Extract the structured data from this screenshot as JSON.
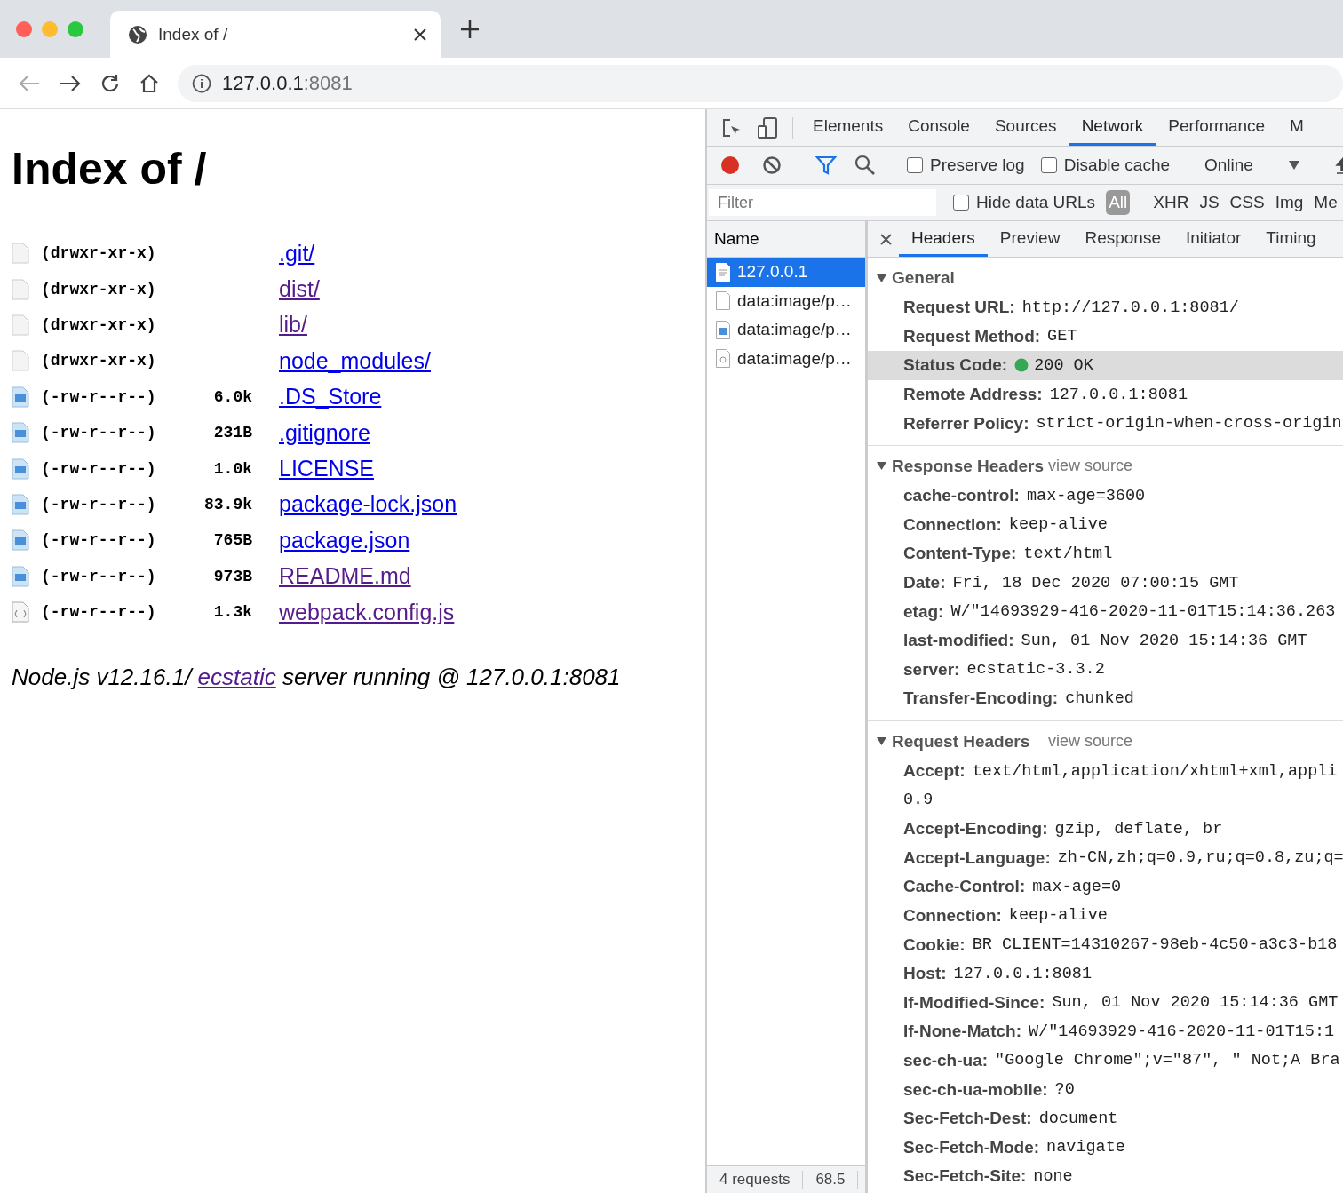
{
  "browser": {
    "tab_title": "Index of /",
    "url_host": "127.0.0.1",
    "url_port": ":8081",
    "back_disabled": true
  },
  "page": {
    "title": "Index of /",
    "entries": [
      {
        "kind": "folder",
        "perms": "(drwxr-xr-x)",
        "name": ".git/",
        "visited": false
      },
      {
        "kind": "folder",
        "perms": "(drwxr-xr-x)",
        "name": "dist/",
        "visited": true
      },
      {
        "kind": "folder",
        "perms": "(drwxr-xr-x)",
        "name": "lib/",
        "visited": true
      },
      {
        "kind": "folder",
        "perms": "(drwxr-xr-x)",
        "name": "node_modules/",
        "visited": false
      },
      {
        "kind": "file",
        "perms": "(-rw-r--r--)",
        "size": "6.0k",
        "name": ".DS_Store",
        "visited": false
      },
      {
        "kind": "file",
        "perms": "(-rw-r--r--)",
        "size": "231B",
        "name": ".gitignore",
        "visited": false
      },
      {
        "kind": "file",
        "perms": "(-rw-r--r--)",
        "size": "1.0k",
        "name": "LICENSE",
        "visited": false
      },
      {
        "kind": "file",
        "perms": "(-rw-r--r--)",
        "size": "83.9k",
        "name": "package-lock.json",
        "visited": false
      },
      {
        "kind": "file",
        "perms": "(-rw-r--r--)",
        "size": "765B",
        "name": "package.json",
        "visited": false
      },
      {
        "kind": "file",
        "perms": "(-rw-r--r--)",
        "size": "973B",
        "name": "README.md",
        "visited": true
      },
      {
        "kind": "script",
        "perms": "(-rw-r--r--)",
        "size": "1.3k",
        "name": "webpack.config.js",
        "visited": true
      }
    ],
    "footer": {
      "before": "Node.js v12.16.1/",
      "link": "ecstatic",
      "link_visited": true,
      "after": "server running @ 127.0.0.1:8081"
    }
  },
  "devtools": {
    "panels": [
      {
        "label": "Elements",
        "selected": false
      },
      {
        "label": "Console",
        "selected": false
      },
      {
        "label": "Sources",
        "selected": false
      },
      {
        "label": "Network",
        "selected": true
      },
      {
        "label": "Performance",
        "selected": false
      },
      {
        "label": "M",
        "selected": false
      }
    ],
    "toolbar": {
      "recording": true,
      "filter_active": true,
      "preserve_log": {
        "label": "Preserve log",
        "checked": false
      },
      "disable_cache": {
        "label": "Disable cache",
        "checked": false
      },
      "throttling": "Online"
    },
    "filter": {
      "placeholder": "Filter",
      "hide_data_urls": {
        "label": "Hide data URLs",
        "checked": false
      },
      "types": [
        {
          "label": "All",
          "selected": true
        },
        {
          "label": "XHR",
          "selected": false
        },
        {
          "label": "JS",
          "selected": false
        },
        {
          "label": "CSS",
          "selected": false
        },
        {
          "label": "Img",
          "selected": false
        },
        {
          "label": "Me",
          "selected": false
        }
      ]
    },
    "name_column": "Name",
    "requests": [
      {
        "kind": "document",
        "name": "127.0.0.1",
        "selected": true
      },
      {
        "kind": "blank",
        "name": "data:image/p…",
        "selected": false
      },
      {
        "kind": "image",
        "name": "data:image/p…",
        "selected": false
      },
      {
        "kind": "picture",
        "name": "data:image/p…",
        "selected": false
      }
    ],
    "summary": [
      "4 requests",
      "68.5"
    ],
    "detail_tabs": [
      {
        "label": "Headers",
        "selected": true
      },
      {
        "label": "Preview",
        "selected": false
      },
      {
        "label": "Response",
        "selected": false
      },
      {
        "label": "Initiator",
        "selected": false
      },
      {
        "label": "Timing",
        "selected": false
      }
    ],
    "sections": [
      {
        "title": "General",
        "expanded": true,
        "rows": [
          {
            "key": "Request URL:",
            "value": "http://127.0.0.1:8081/",
            "highlighted": false
          },
          {
            "key": "Request Method:",
            "value": "GET",
            "highlighted": false
          },
          {
            "key": "Status Code:",
            "value": "200  OK",
            "status_ok": true,
            "highlighted": true
          },
          {
            "key": "Remote Address:",
            "value": "127.0.0.1:8081",
            "highlighted": false
          },
          {
            "key": "Referrer Policy:",
            "value": "strict-origin-when-cross-origin",
            "highlighted": false
          }
        ]
      },
      {
        "title": "Response Headers",
        "link": "view source",
        "expanded": true,
        "rows": [
          {
            "key": "cache-control:",
            "value": "max-age=3600"
          },
          {
            "key": "Connection:",
            "value": "keep-alive"
          },
          {
            "key": "Content-Type:",
            "value": "text/html"
          },
          {
            "key": "Date:",
            "value": "Fri, 18 Dec 2020 07:00:15 GMT"
          },
          {
            "key": "etag:",
            "value": "W/\"14693929-416-2020-11-01T15:14:36.263"
          },
          {
            "key": "last-modified:",
            "value": "Sun, 01 Nov 2020 15:14:36 GMT"
          },
          {
            "key": "server:",
            "value": "ecstatic-3.3.2"
          },
          {
            "key": "Transfer-Encoding:",
            "value": "chunked"
          }
        ]
      },
      {
        "title": "Request Headers",
        "link": "view source",
        "expanded": true,
        "rows": [
          {
            "key": "Accept:",
            "value": "text/html,application/xhtml+xml,appli",
            "continued": "0.9"
          },
          {
            "key": "Accept-Encoding:",
            "value": "gzip, deflate, br"
          },
          {
            "key": "Accept-Language:",
            "value": "zh-CN,zh;q=0.9,ru;q=0.8,zu;q="
          },
          {
            "key": "Cache-Control:",
            "value": "max-age=0"
          },
          {
            "key": "Connection:",
            "value": "keep-alive"
          },
          {
            "key": "Cookie:",
            "value": "BR_CLIENT=14310267-98eb-4c50-a3c3-b18"
          },
          {
            "key": "Host:",
            "value": "127.0.0.1:8081"
          },
          {
            "key": "If-Modified-Since:",
            "value": "Sun, 01 Nov 2020 15:14:36 GMT"
          },
          {
            "key": "If-None-Match:",
            "value": "W/\"14693929-416-2020-11-01T15:1"
          },
          {
            "key": "sec-ch-ua:",
            "value": "\"Google Chrome\";v=\"87\", \" Not;A Bra"
          },
          {
            "key": "sec-ch-ua-mobile:",
            "value": "?0"
          },
          {
            "key": "Sec-Fetch-Dest:",
            "value": "document"
          },
          {
            "key": "Sec-Fetch-Mode:",
            "value": "navigate"
          },
          {
            "key": "Sec-Fetch-Site:",
            "value": "none"
          }
        ]
      }
    ]
  }
}
